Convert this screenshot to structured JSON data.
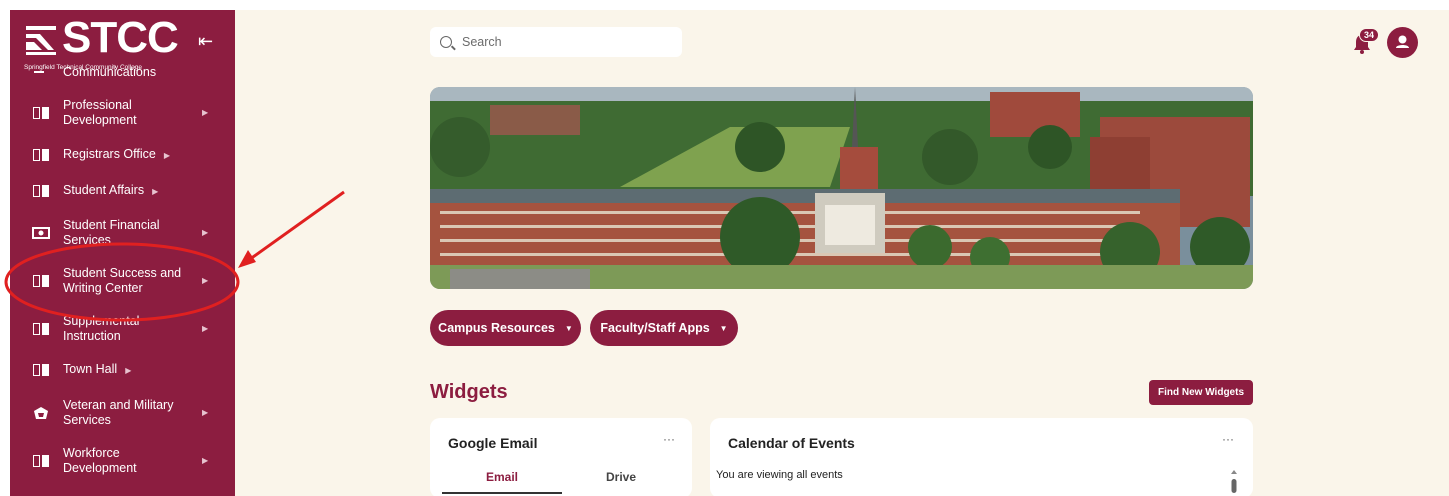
{
  "sidebar": {
    "logo": {
      "wordmark": "STCC",
      "subtitle": "Springfield Technical Community College"
    },
    "collapse_icon": "collapse-left-arrow-icon",
    "partial_item": "Communications",
    "items": [
      {
        "label": "Professional Development",
        "icon": "book-icon"
      },
      {
        "label": "Registrars Office",
        "icon": "book-icon"
      },
      {
        "label": "Student Affairs",
        "icon": "book-icon"
      },
      {
        "label": "Student Financial Services",
        "icon": "money-icon"
      },
      {
        "label": "Student Success and Writing Center",
        "icon": "book-icon"
      },
      {
        "label": "Supplemental Instruction",
        "icon": "book-icon"
      },
      {
        "label": "Town Hall",
        "icon": "book-icon"
      },
      {
        "label": "Veteran and Military Services",
        "icon": "veteran-icon"
      },
      {
        "label": "Workforce Development",
        "icon": "book-icon"
      }
    ]
  },
  "header": {
    "search_placeholder": "Search",
    "notification_count": "34"
  },
  "buttons": {
    "campus_resources": "Campus Resources",
    "faculty_staff_apps": "Faculty/Staff Apps",
    "find_new_widgets": "Find New Widgets"
  },
  "widgets": {
    "title": "Widgets",
    "google_email": {
      "title": "Google Email",
      "more": "···",
      "tabs": [
        "Email",
        "Drive"
      ]
    },
    "calendar": {
      "title": "Calendar of Events",
      "more": "···",
      "viewing_text": "You are viewing all events"
    }
  },
  "colors": {
    "brand": "#8c1d40",
    "background": "#faf5ea",
    "annotation": "#e02020"
  }
}
